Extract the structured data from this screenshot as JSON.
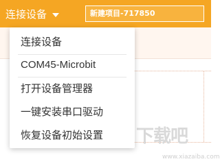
{
  "toolbar": {
    "connect_label": "连接设备",
    "project_name": "新建项目-717850",
    "accent_color": "#f5a623"
  },
  "menu": {
    "items": [
      {
        "label": "连接设备"
      },
      {
        "label": "COM45-Microbit"
      },
      {
        "label": "打开设备管理器"
      },
      {
        "label": "一键安装串口驱动"
      },
      {
        "label": "恢复设备初始设置"
      }
    ]
  },
  "watermark": {
    "text": "下载吧",
    "sub": "www.xiazaiba.com"
  }
}
